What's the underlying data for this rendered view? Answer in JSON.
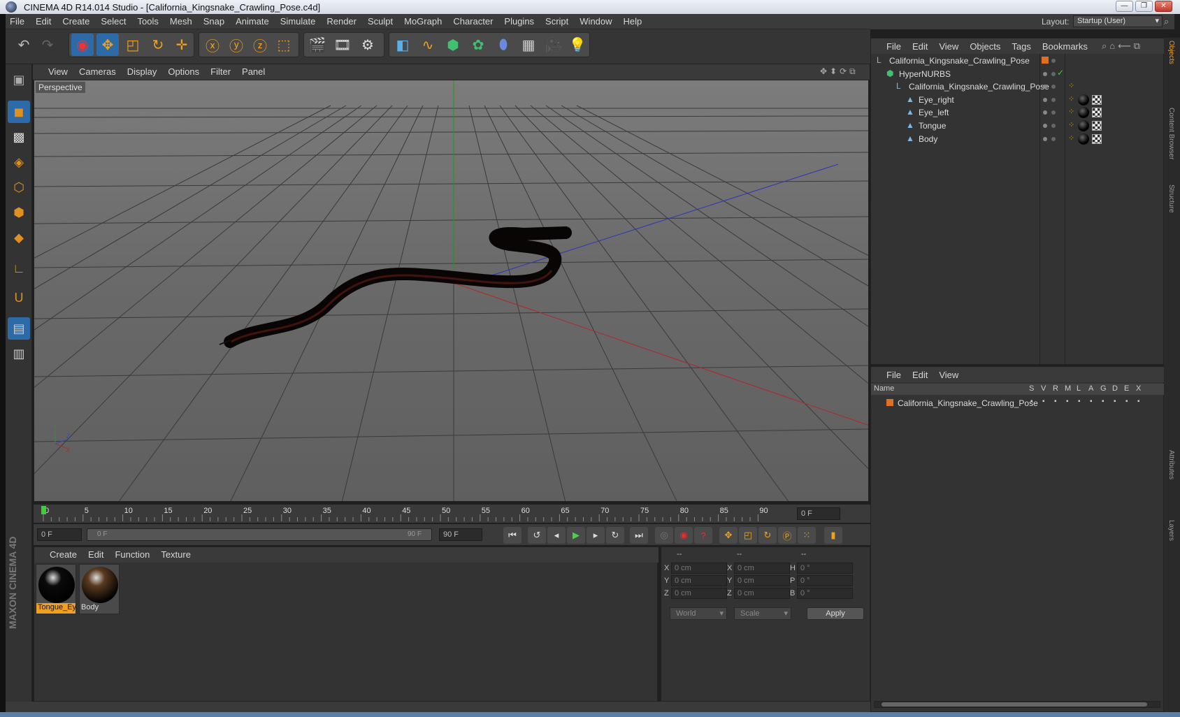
{
  "window": {
    "title": "CINEMA 4D R14.014 Studio - [California_Kingsnake_Crawling_Pose.c4d]",
    "minimize": "—",
    "restore": "❐",
    "close": "✕"
  },
  "menubar": [
    "File",
    "Edit",
    "Create",
    "Select",
    "Tools",
    "Mesh",
    "Snap",
    "Animate",
    "Simulate",
    "Render",
    "Sculpt",
    "MoGraph",
    "Character",
    "Plugins",
    "Script",
    "Window",
    "Help"
  ],
  "layout": {
    "label": "Layout:",
    "value": "Startup (User)"
  },
  "viewport": {
    "menu": [
      "View",
      "Cameras",
      "Display",
      "Options",
      "Filter",
      "Panel"
    ],
    "label": "Perspective",
    "axis_labels": {
      "y": "Y",
      "z": "Z",
      "x": "X"
    }
  },
  "timeline": {
    "ticks": [
      "0",
      "5",
      "10",
      "15",
      "20",
      "25",
      "30",
      "35",
      "40",
      "45",
      "50",
      "55",
      "60",
      "65",
      "70",
      "75",
      "80",
      "85",
      "90"
    ],
    "current_frame": "0 F",
    "start": "0 F",
    "range_start": "0 F",
    "range_end": "90 F",
    "end": "90 F"
  },
  "material_panel": {
    "menu": [
      "Create",
      "Edit",
      "Function",
      "Texture"
    ],
    "materials": [
      {
        "name": "Tongue_Ey",
        "selected": true,
        "color": "#0a0a0a"
      },
      {
        "name": "Body",
        "selected": false,
        "color": "#5a3a20"
      }
    ]
  },
  "coord_panel": {
    "headers": [
      "--",
      "--",
      "--"
    ],
    "rows": [
      {
        "l1": "X",
        "v1": "0 cm",
        "l2": "X",
        "v2": "0 cm",
        "l3": "H",
        "v3": "0 °"
      },
      {
        "l1": "Y",
        "v1": "0 cm",
        "l2": "Y",
        "v2": "0 cm",
        "l3": "P",
        "v3": "0 °"
      },
      {
        "l1": "Z",
        "v1": "0 cm",
        "l2": "Z",
        "v2": "0 cm",
        "l3": "B",
        "v3": "0 °"
      }
    ],
    "mode": "World",
    "transform": "Scale",
    "apply": "Apply"
  },
  "objects_panel": {
    "menu": [
      "File",
      "Edit",
      "View",
      "Objects",
      "Tags",
      "Bookmarks"
    ],
    "items": [
      {
        "name": "California_Kingsnake_Crawling_Pose",
        "depth": 0
      },
      {
        "name": "HyperNURBS",
        "depth": 1
      },
      {
        "name": "California_Kingsnake_Crawling_Pose",
        "depth": 2
      },
      {
        "name": "Eye_right",
        "depth": 3
      },
      {
        "name": "Eye_left",
        "depth": 3
      },
      {
        "name": "Tongue",
        "depth": 3
      },
      {
        "name": "Body",
        "depth": 3
      }
    ]
  },
  "layers_panel": {
    "menu": [
      "File",
      "Edit",
      "View"
    ],
    "columns": [
      "Name",
      "S",
      "V",
      "R",
      "M",
      "L",
      "A",
      "G",
      "D",
      "E",
      "X"
    ],
    "layers": [
      {
        "name": "California_Kingsnake_Crawling_Pose"
      }
    ]
  },
  "side_tabs": [
    "Objects",
    "Content Browser",
    "Structure",
    "Attributes",
    "Layers"
  ],
  "branding": {
    "line1": "MAXON",
    "line2": "CINEMA 4D"
  },
  "colors": {
    "accent": "#f0a020",
    "selection": "#2d6aa8",
    "x_axis": "#c03030",
    "y_axis": "#30a030",
    "z_axis": "#3040c0"
  }
}
